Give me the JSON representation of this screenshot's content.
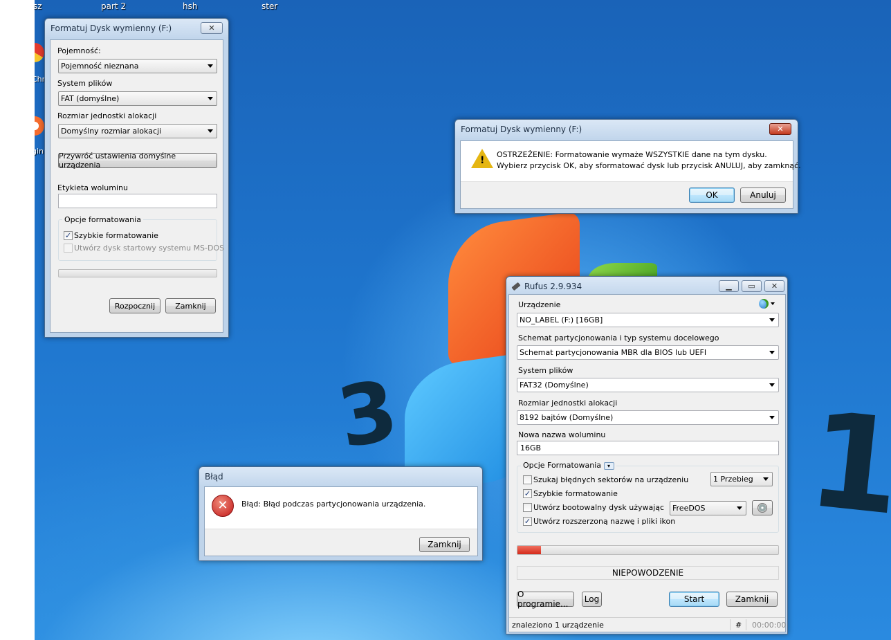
{
  "desktop": {
    "labels": [
      "sz",
      "part 2",
      "hsh",
      "ster"
    ],
    "icon_labels": [
      "Chr",
      "gin"
    ],
    "digits": [
      "3",
      "1"
    ]
  },
  "format_window": {
    "title": "Formatuj Dysk wymienny (F:)",
    "capacity_label": "Pojemność:",
    "capacity_value": "Pojemność nieznana",
    "fs_label": "System plików",
    "fs_value": "FAT (domyślne)",
    "alloc_label": "Rozmiar jednostki alokacji",
    "alloc_value": "Domyślny rozmiar alokacji",
    "restore_button": "Przywróć ustawienia domyślne urządzenia",
    "volume_label": "Etykieta woluminu",
    "volume_value": "",
    "options_title": "Opcje formatowania",
    "quick_format": "Szybkie formatowanie",
    "msdos": "Utwórz dysk startowy systemu MS-DOS",
    "start_button": "Rozpocznij",
    "close_button": "Zamknij",
    "progress": 0
  },
  "warning_dialog": {
    "title": "Formatuj Dysk wymienny (F:)",
    "line1": "OSTRZEŻENIE: Formatowanie wymaże WSZYSTKIE dane na tym dysku.",
    "line2": "Wybierz przycisk OK, aby sformatować dysk lub przycisk ANULUJ, aby zamknąć.",
    "ok": "OK",
    "cancel": "Anuluj",
    "close_glyph": "✕"
  },
  "error_dialog": {
    "title": "Błąd",
    "message": "Błąd: Błąd podczas partycjonowania urządzenia.",
    "close_button": "Zamknij"
  },
  "rufus": {
    "title": "Rufus 2.9.934",
    "device_label": "Urządzenie",
    "device_value": "NO_LABEL (F:) [16GB]",
    "scheme_label": "Schemat partycjonowania i typ systemu docelowego",
    "scheme_value": "Schemat partycjonowania MBR dla BIOS lub UEFI",
    "fs_label": "System plików",
    "fs_value": "FAT32 (Domyślne)",
    "cluster_label": "Rozmiar jednostki alokacji",
    "cluster_value": "8192 bajtów (Domyślne)",
    "volume_label": "Nowa nazwa woluminu",
    "volume_value": "16GB",
    "options_title": "Opcje Formatowania",
    "bad_blocks": "Szukaj błędnych sektorów na urządzeniu",
    "passes_value": "1 Przebieg",
    "quick_format": "Szybkie formatowanie",
    "bootable": "Utwórz bootowalny dysk używając",
    "boot_type": "FreeDOS",
    "extended_label": "Utwórz rozszerzoną nazwę i pliki ikon",
    "progress": 0.09,
    "status": "NIEPOWODZENIE",
    "about_button": "O programie...",
    "log_button": "Log",
    "start_button": "Start",
    "close_button": "Zamknij",
    "footer_status": "znaleziono 1 urządzenie",
    "footer_hash": "#",
    "footer_time": "00:00:00",
    "colors": {
      "progress_fill": "#d42a1a"
    }
  }
}
